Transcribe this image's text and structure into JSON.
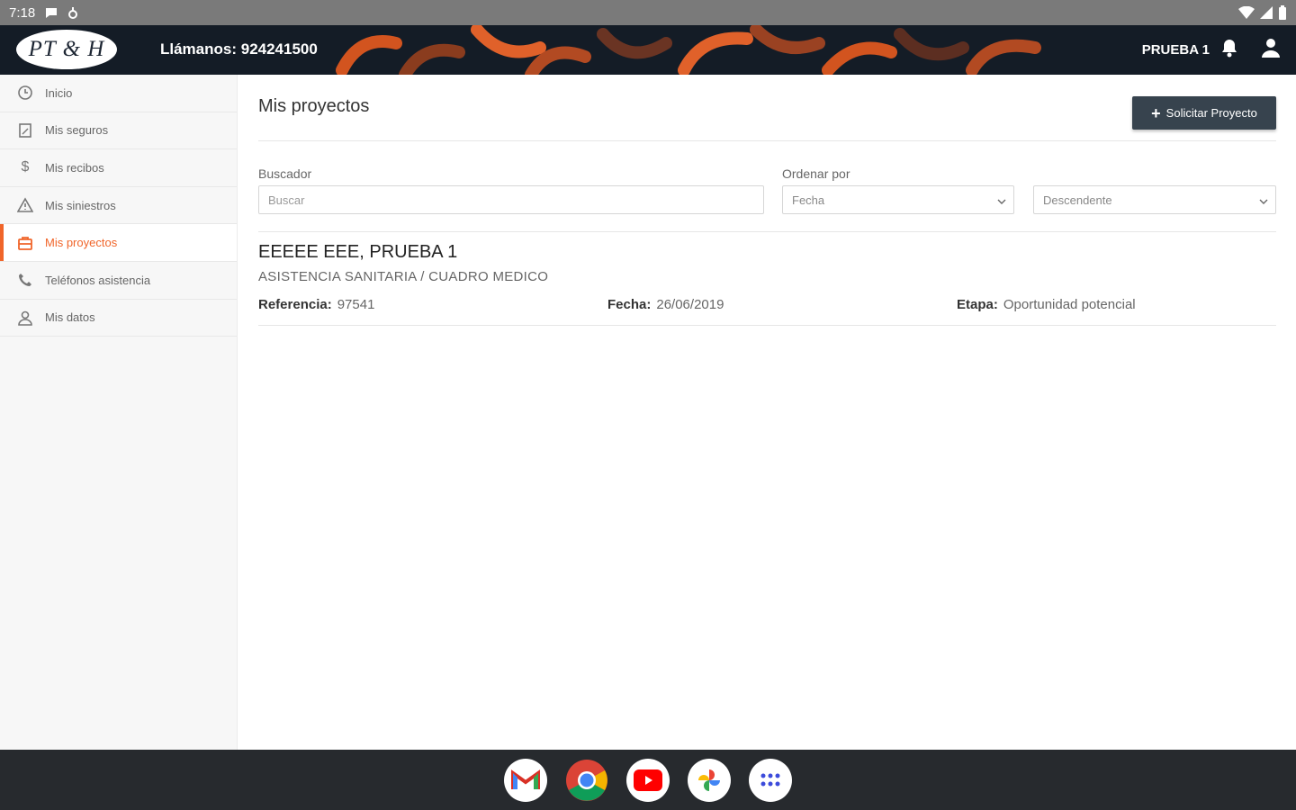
{
  "statusbar": {
    "time": "7:18"
  },
  "header": {
    "logo_text": "PT & H",
    "phone_label": "Llámanos: 924241500",
    "user_name": "PRUEBA 1"
  },
  "sidebar": {
    "items": [
      {
        "label": "Inicio",
        "icon": "clock-icon"
      },
      {
        "label": "Mis seguros",
        "icon": "document-icon"
      },
      {
        "label": "Mis recibos",
        "icon": "dollar-icon"
      },
      {
        "label": "Mis siniestros",
        "icon": "warning-icon"
      },
      {
        "label": "Mis proyectos",
        "icon": "briefcase-icon",
        "active": true
      },
      {
        "label": "Teléfonos asistencia",
        "icon": "phone-icon"
      },
      {
        "label": "Mis datos",
        "icon": "user-icon"
      }
    ]
  },
  "main": {
    "title": "Mis proyectos",
    "request_button": "Solicitar Proyecto",
    "search": {
      "label": "Buscador",
      "placeholder": "Buscar"
    },
    "order": {
      "label": "Ordenar por",
      "field_value": "Fecha",
      "direction_value": "Descendente"
    },
    "project": {
      "title": "EEEEE EEE, PRUEBA 1",
      "subtitle": "ASISTENCIA SANITARIA / CUADRO MEDICO",
      "reference_label": "Referencia:",
      "reference_value": "97541",
      "date_label": "Fecha:",
      "date_value": "26/06/2019",
      "stage_label": "Etapa:",
      "stage_value": "Oportunidad potencial"
    }
  },
  "colors": {
    "accent": "#f0652a",
    "header_bg": "#141c26",
    "button_bg": "#37434e"
  },
  "taskbar": {
    "apps": [
      "gmail-icon",
      "chrome-icon",
      "youtube-icon",
      "photos-icon",
      "app-drawer-icon"
    ]
  }
}
